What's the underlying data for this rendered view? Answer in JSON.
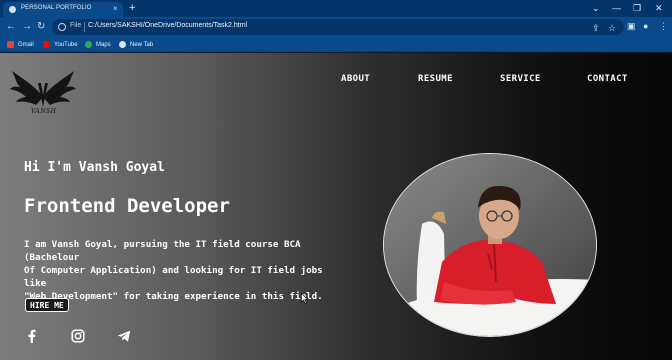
{
  "browser": {
    "tab_title": "PERSONAL PORTFOLIO",
    "close_glyph": "×",
    "new_tab_glyph": "+",
    "file_label": "File",
    "url": "C:/Users/SAKSHI/OneDrive/Documents/Task2.html",
    "bookmarks": [
      {
        "label": "Gmail",
        "icon": "gmail-icon",
        "color": "#ea4335"
      },
      {
        "label": "YouTube",
        "icon": "youtube-icon",
        "color": "#ff0000"
      },
      {
        "label": "Maps",
        "icon": "maps-icon",
        "color": "#34a853"
      },
      {
        "label": "New Tab",
        "icon": "globe-icon",
        "color": "#d8e4f4"
      }
    ]
  },
  "logo": {
    "text": "VANSH"
  },
  "nav": [
    "ABOUT",
    "RESUME",
    "SERVICE",
    "CONTACT"
  ],
  "hero": {
    "greeting": "Hi I'm Vansh Goyal",
    "role": "Frontend Developer",
    "bio_lines": [
      "I am Vansh Goyal, pursuing the IT field course BCA (Bachelour",
      "Of Computer Application) and looking for IT field jobs like",
      "\"Web Development\" for taking experience in this field."
    ],
    "button": "HIRE ME"
  },
  "social": [
    "facebook-icon",
    "instagram-icon",
    "telegram-icon"
  ],
  "colors": {
    "chrome_dark": "#03356b",
    "chrome": "#0a4a8a",
    "text": "#ffffff"
  }
}
